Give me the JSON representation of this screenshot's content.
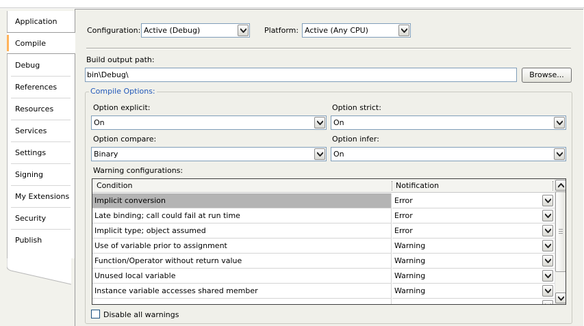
{
  "tabs": [
    {
      "label": "Application"
    },
    {
      "label": "Compile",
      "selected": true
    },
    {
      "label": "Debug"
    },
    {
      "label": "References"
    },
    {
      "label": "Resources"
    },
    {
      "label": "Services"
    },
    {
      "label": "Settings"
    },
    {
      "label": "Signing"
    },
    {
      "label": "My Extensions"
    },
    {
      "label": "Security"
    },
    {
      "label": "Publish"
    }
  ],
  "config": {
    "configuration_label": "Configuration:",
    "configuration_value": "Active (Debug)",
    "platform_label": "Platform:",
    "platform_value": "Active (Any CPU)"
  },
  "build": {
    "output_path_label": "Build output path:",
    "output_path_value": "bin\\Debug\\",
    "browse_label": "Browse..."
  },
  "compile_options": {
    "title": "Compile Options:",
    "option_explicit_label": "Option explicit:",
    "option_explicit_value": "On",
    "option_strict_label": "Option strict:",
    "option_strict_value": "On",
    "option_compare_label": "Option compare:",
    "option_compare_value": "Binary",
    "option_infer_label": "Option infer:",
    "option_infer_value": "On"
  },
  "warnings": {
    "label": "Warning configurations:",
    "columns": [
      "Condition",
      "Notification"
    ],
    "rows": [
      {
        "condition": "Implicit conversion",
        "notification": "Error"
      },
      {
        "condition": "Late binding; call could fail at run time",
        "notification": "Error"
      },
      {
        "condition": "Implicit type; object assumed",
        "notification": "Error"
      },
      {
        "condition": "Use of variable prior to assignment",
        "notification": "Warning"
      },
      {
        "condition": "Function/Operator without return value",
        "notification": "Warning"
      },
      {
        "condition": "Unused local variable",
        "notification": "Warning"
      },
      {
        "condition": "Instance variable accesses shared member",
        "notification": "Warning"
      },
      {
        "condition": "",
        "notification": ""
      }
    ],
    "disable_all_label": "Disable all warnings"
  },
  "colors": {
    "accent_tab": "#ffb35a",
    "group_title": "#2158b9",
    "selected_row": "#b4b4b4"
  },
  "icons": {
    "dropdown": "chevron-down-icon",
    "scroll_up": "chevron-up-icon",
    "scroll_down": "chevron-down-icon"
  }
}
